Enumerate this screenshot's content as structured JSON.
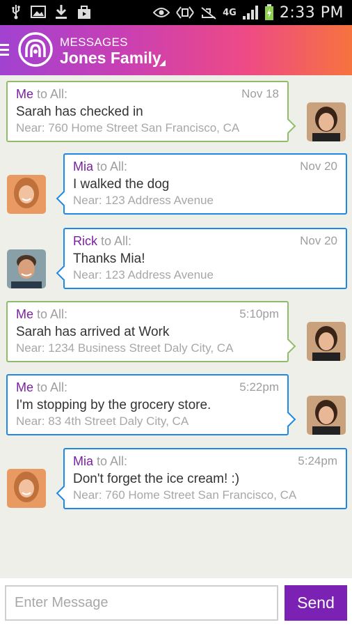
{
  "status_bar": {
    "time": "2:33 PM",
    "network": "4G",
    "icons": [
      "usb-icon",
      "image-icon",
      "download-icon",
      "shopping-bag-icon",
      "eye-icon",
      "nfc-icon",
      "mute-icon",
      "4g-signal-icon",
      "signal-bars-icon",
      "battery-charging-icon"
    ]
  },
  "header": {
    "subtitle": "MESSAGES",
    "title": "Jones Family",
    "logo": "life360-logo",
    "menu_icon": "hamburger-menu-icon",
    "accent_colors": [
      "#a142d1",
      "#ee4a86",
      "#f6733e"
    ]
  },
  "messages": [
    {
      "sender": "Me",
      "to": " to All:",
      "time": "Nov 18",
      "text": "Sarah has checked in",
      "location": "Near: 760 Home Street San Francisco, CA",
      "avatar": "sarah-avatar"
    },
    {
      "sender": "Mia",
      "to": " to All:",
      "time": "Nov 20",
      "text": "I walked the dog",
      "location": "Near: 123 Address Avenue",
      "avatar": "mia-avatar"
    },
    {
      "sender": "Rick",
      "to": " to All:",
      "time": "Nov 20",
      "text": "Thanks Mia!",
      "location": "Near: 123 Address Avenue",
      "avatar": "rick-avatar"
    },
    {
      "sender": "Me",
      "to": " to All:",
      "time": "5:10pm",
      "text": "Sarah has arrived at Work",
      "location": "Near: 1234 Business Street Daly City, CA",
      "avatar": "sarah-avatar"
    },
    {
      "sender": "Me",
      "to": " to All:",
      "time": "5:22pm",
      "text": "I'm stopping by the grocery store.",
      "location": "Near: 83 4th Street Daly City, CA",
      "avatar": "sarah-avatar"
    },
    {
      "sender": "Mia",
      "to": " to All:",
      "time": "5:24pm",
      "text": "Don't forget the ice cream! :)",
      "location": "Near: 760 Home Street San Francisco, CA",
      "avatar": "mia-avatar"
    }
  ],
  "composer": {
    "placeholder": "Enter Message",
    "send_label": "Send",
    "send_color": "#7b22b5"
  },
  "colors": {
    "sender": "#7b1fa2",
    "own_border": "#8fbc6b",
    "other_border": "#1e88e5",
    "background": "#efefe9"
  }
}
